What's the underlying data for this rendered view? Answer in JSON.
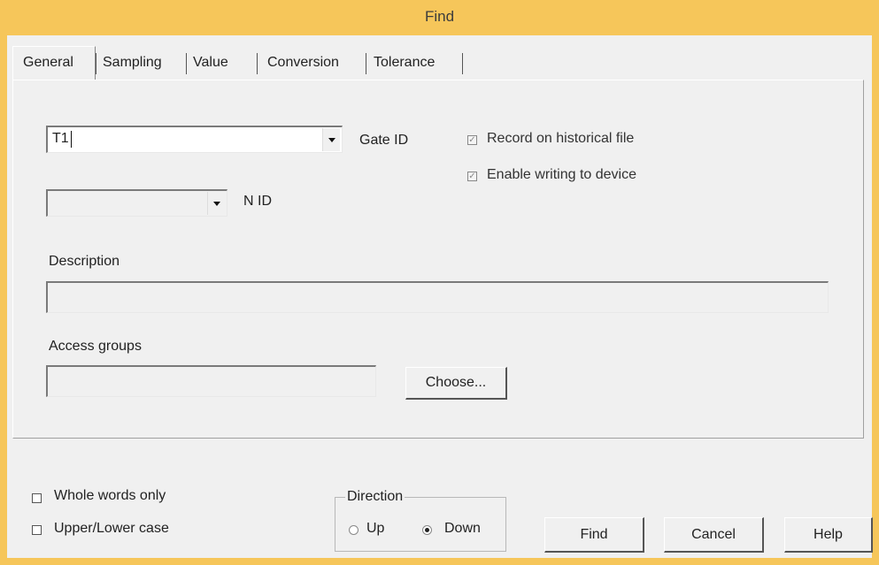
{
  "window": {
    "title": "Find"
  },
  "tabs": [
    {
      "label": "General"
    },
    {
      "label": "Sampling"
    },
    {
      "label": "Value"
    },
    {
      "label": "Conversion"
    },
    {
      "label": "Tolerance"
    }
  ],
  "general": {
    "gate_id": {
      "value": "T1",
      "label": "Gate ID"
    },
    "n_id": {
      "value": "",
      "label": "N ID"
    },
    "record_historical": {
      "label": "Record on historical file",
      "checked": true,
      "enabled": false
    },
    "enable_writing": {
      "label": "Enable writing to device",
      "checked": true,
      "enabled": false
    },
    "description": {
      "label": "Description",
      "value": ""
    },
    "access_groups": {
      "label": "Access groups",
      "value": "",
      "choose_label": "Choose..."
    }
  },
  "options": {
    "whole_words": {
      "label": "Whole words only",
      "checked": false
    },
    "upper_lower": {
      "label": "Upper/Lower case",
      "checked": false
    }
  },
  "direction": {
    "legend": "Direction",
    "up_label": "Up",
    "down_label": "Down",
    "selected": "Down"
  },
  "buttons": {
    "find": "Find",
    "cancel": "Cancel",
    "help": "Help"
  },
  "colors": {
    "titlebar": "#f6c65a",
    "dialog_bg": "#f0f0f0"
  }
}
